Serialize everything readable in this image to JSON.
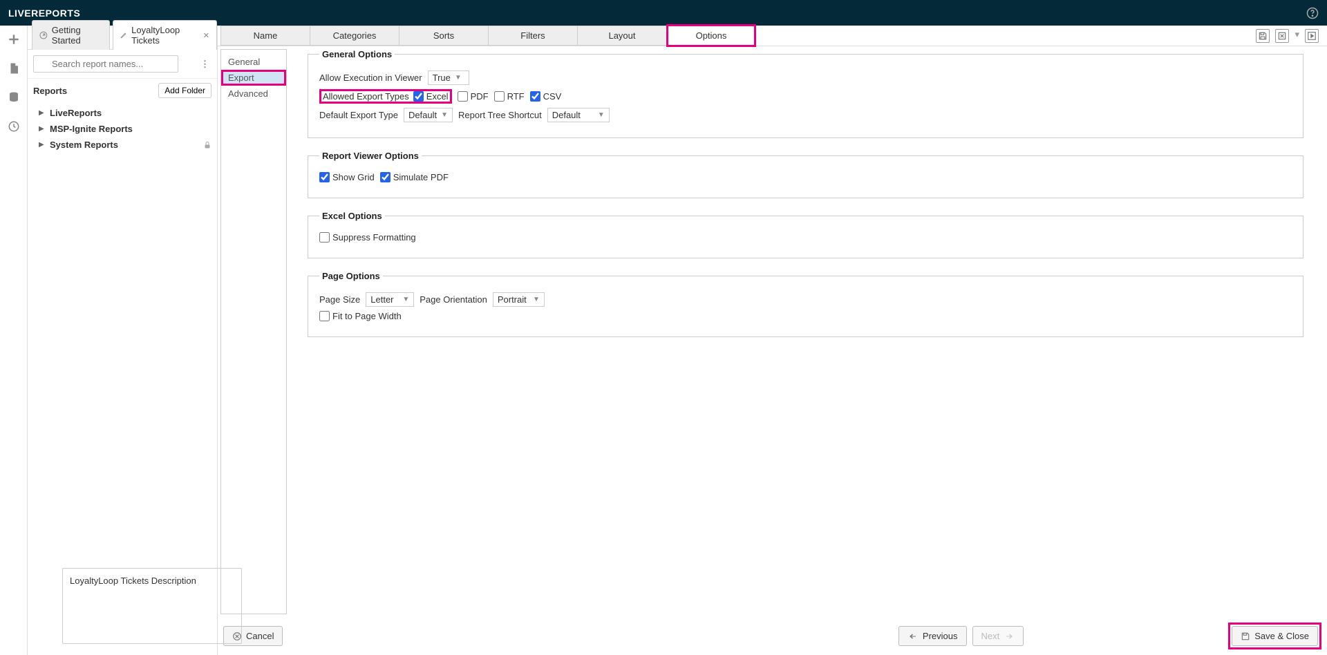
{
  "header": {
    "title": "LIVEREPORTS"
  },
  "tabs": {
    "getting_started": "Getting Started",
    "loyalty": "LoyaltyLoop Tickets"
  },
  "search": {
    "placeholder": "Search report names..."
  },
  "reports": {
    "header": "Reports",
    "add_folder": "Add Folder",
    "tree": {
      "live_reports": "LiveReports",
      "msp_ignite": "MSP-Ignite Reports",
      "system_reports": "System Reports"
    }
  },
  "description": "LoyaltyLoop Tickets Description",
  "main_tabs": {
    "name": "Name",
    "categories": "Categories",
    "sorts": "Sorts",
    "filters": "Filters",
    "layout": "Layout",
    "options": "Options"
  },
  "options_sidebar": {
    "general": "General",
    "export": "Export",
    "advanced": "Advanced"
  },
  "general_options": {
    "legend": "General Options",
    "allow_exec_label": "Allow Execution in Viewer",
    "allow_exec_value": "True",
    "allowed_export_label": "Allowed Export Types",
    "excel": "Excel",
    "pdf": "PDF",
    "rtf": "RTF",
    "csv": "CSV",
    "default_export_label": "Default Export Type",
    "default_export_value": "Default",
    "tree_shortcut_label": "Report Tree Shortcut",
    "tree_shortcut_value": "Default"
  },
  "viewer_options": {
    "legend": "Report Viewer Options",
    "show_grid": "Show Grid",
    "simulate_pdf": "Simulate PDF"
  },
  "excel_options": {
    "legend": "Excel Options",
    "suppress": "Suppress Formatting"
  },
  "page_options": {
    "legend": "Page Options",
    "page_size_label": "Page Size",
    "page_size_value": "Letter",
    "orientation_label": "Page Orientation",
    "orientation_value": "Portrait",
    "fit_width": "Fit to Page Width"
  },
  "footer": {
    "cancel": "Cancel",
    "previous": "Previous",
    "next": "Next",
    "save_close": "Save & Close"
  }
}
